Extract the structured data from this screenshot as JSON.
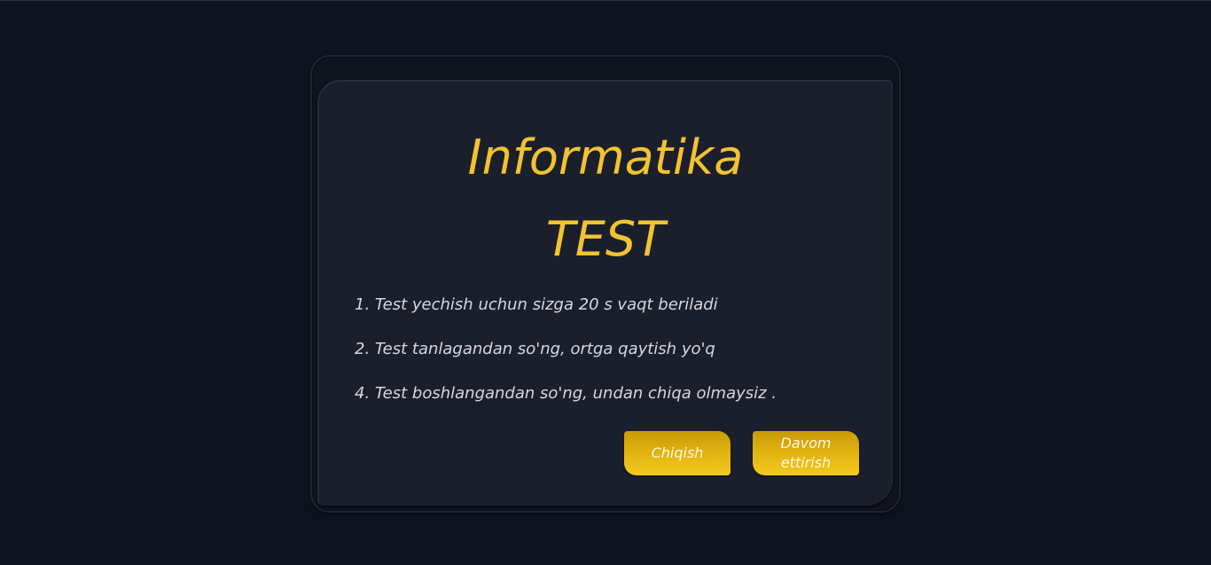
{
  "quiz": {
    "title_line1": "Informatika",
    "title_line2": "TEST",
    "rules": [
      "1. Test yechish uchun sizga 20 s vaqt beriladi",
      "2. Test tanlagandan so'ng, ortga qaytish yo'q",
      "4. Test boshlangandan so'ng, undan chiqa olmaysiz ."
    ],
    "buttons": {
      "exit_label": "Chiqish",
      "continue_label": "Davom ettirish"
    }
  },
  "colors": {
    "background": "#0e1320",
    "card": "#1b1f2c",
    "accent": "#f2c330",
    "text": "#d6d8de"
  }
}
